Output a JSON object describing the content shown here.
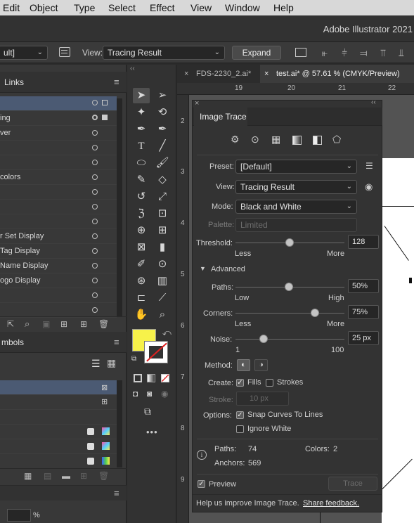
{
  "menu": [
    "Edit",
    "Object",
    "Type",
    "Select",
    "Effect",
    "View",
    "Window",
    "Help"
  ],
  "app_title": "Adobe Illustrator 2021",
  "control_bar": {
    "preset_value": "ult]",
    "view_label": "View:",
    "view_value": "Tracing Result",
    "expand_label": "Expand"
  },
  "links_panel": {
    "title": "Links",
    "rows": [
      "",
      "ing",
      "ver",
      "",
      "",
      "colors",
      "",
      "",
      "",
      "r Set Display",
      "Tag Display",
      "Name Display",
      "ogo Display",
      "",
      ""
    ]
  },
  "symbols_panel": {
    "title": "mbols",
    "percent_symbol": "%"
  },
  "doc_tabs": [
    {
      "label": "FDS-2230_2.ai*",
      "active": false
    },
    {
      "label": "test.ai* @ 57.61 % (CMYK/Preview)",
      "active": true
    }
  ],
  "ruler": {
    "h_ticks": [
      "19",
      "20",
      "21",
      "22"
    ],
    "v_ticks": [
      "2",
      "3",
      "4",
      "5",
      "6",
      "7",
      "8",
      "9"
    ]
  },
  "image_trace": {
    "title": "Image Trace",
    "preset_label": "Preset:",
    "preset_value": "[Default]",
    "view_label": "View:",
    "view_value": "Tracing Result",
    "mode_label": "Mode:",
    "mode_value": "Black and White",
    "palette_label": "Palette:",
    "palette_value": "Limited",
    "threshold_label": "Threshold:",
    "threshold_value": "128",
    "threshold_level": 0.5,
    "less_label": "Less",
    "more_label": "More",
    "advanced_label": "Advanced",
    "paths_label": "Paths:",
    "paths_value": "50%",
    "paths_level": 0.5,
    "low_label": "Low",
    "high_label": "High",
    "corners_label": "Corners:",
    "corners_value": "75%",
    "corners_level": 0.75,
    "noise_label": "Noise:",
    "noise_value": "25 px",
    "noise_level": 0.24,
    "noise_min": "1",
    "noise_max": "100",
    "method_label": "Method:",
    "create_label": "Create:",
    "fills_label": "Fills",
    "fills_checked": true,
    "strokes_label": "Strokes",
    "strokes_checked": false,
    "stroke_label": "Stroke:",
    "stroke_value": "10 px",
    "options_label": "Options:",
    "snap_label": "Snap Curves To Lines",
    "snap_checked": true,
    "ignore_white_label": "Ignore White",
    "ignore_white_checked": false,
    "paths_stat_label": "Paths:",
    "paths_stat_value": "74",
    "colors_stat_label": "Colors:",
    "colors_stat_value": "2",
    "anchors_stat_label": "Anchors:",
    "anchors_stat_value": "569",
    "preview_label": "Preview",
    "preview_checked": true,
    "trace_label": "Trace",
    "feedback_text": "Help us improve Image Trace.",
    "feedback_link": "Share feedback."
  },
  "colors": {
    "fill_swatch": "#f7f24a",
    "selected_row": "#4b5a73"
  }
}
